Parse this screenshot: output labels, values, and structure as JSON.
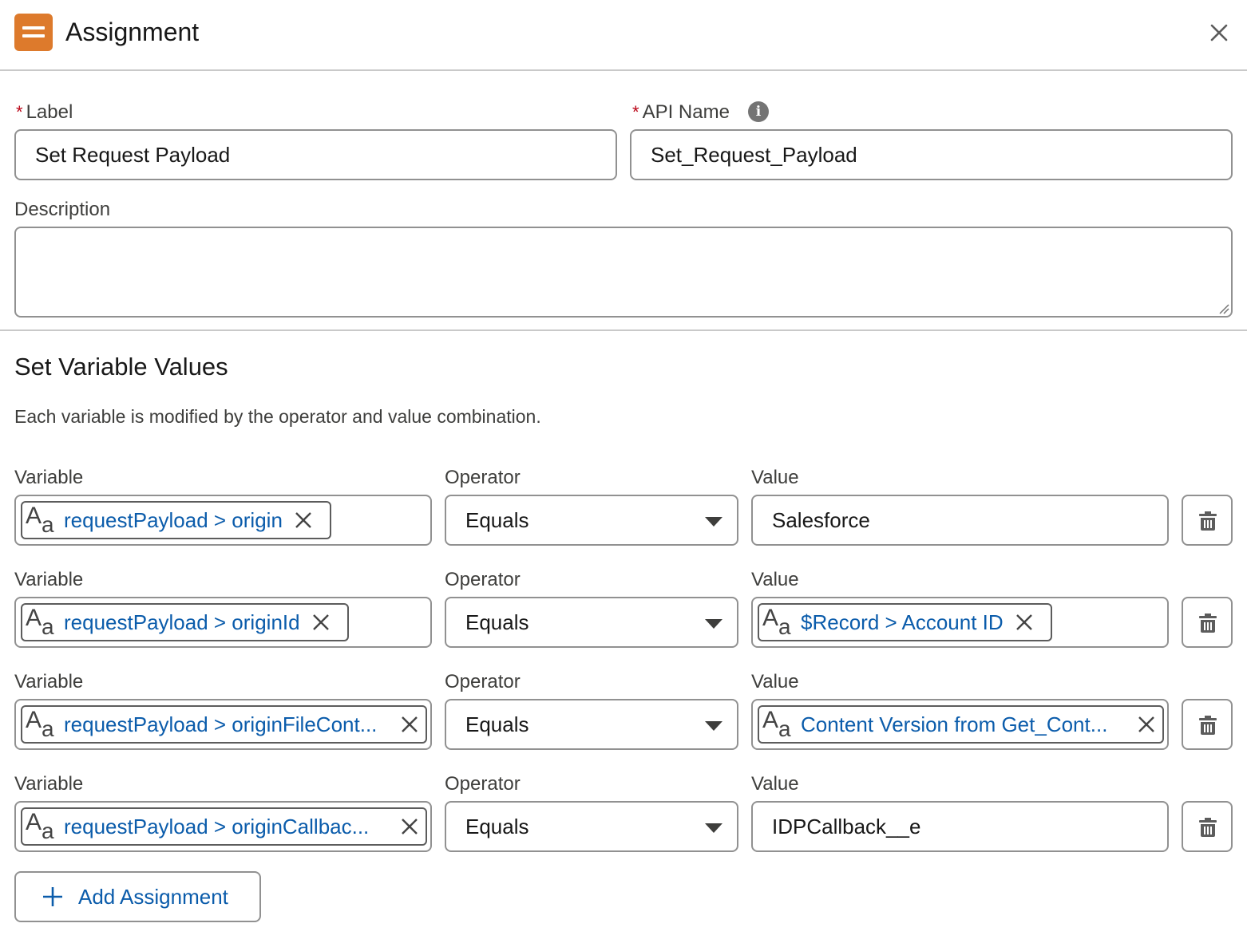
{
  "header": {
    "title": "Assignment",
    "icon": "assignment-icon",
    "icon_color": "#dd7a2c"
  },
  "form": {
    "label_field": {
      "label": "Label",
      "required_mark": "*",
      "value": "Set Request Payload"
    },
    "api_name_field": {
      "label": "API Name",
      "required_mark": "*",
      "value": "Set_Request_Payload",
      "info_icon": "info-icon"
    },
    "description_field": {
      "label": "Description",
      "value": ""
    }
  },
  "section": {
    "title": "Set Variable Values",
    "description": "Each variable is modified by the operator and value combination."
  },
  "columns": {
    "variable": "Variable",
    "operator": "Operator",
    "value": "Value"
  },
  "assignments": [
    {
      "variable": "requestPayload > origin",
      "operator": "Equals",
      "value": "Salesforce",
      "value_is_resource": false
    },
    {
      "variable": "requestPayload > originId",
      "operator": "Equals",
      "value": "$Record > Account ID",
      "value_is_resource": true
    },
    {
      "variable": "requestPayload > originFileCont...",
      "operator": "Equals",
      "value": "Content Version from Get_Cont...",
      "value_is_resource": true
    },
    {
      "variable": "requestPayload > originCallbac...",
      "operator": "Equals",
      "value": "IDPCallback__e",
      "value_is_resource": false
    }
  ],
  "add_button": {
    "label": "Add Assignment",
    "icon": "plus-icon"
  },
  "colors": {
    "link": "#0b5cab",
    "required": "#ba0517",
    "border": "#919191"
  }
}
